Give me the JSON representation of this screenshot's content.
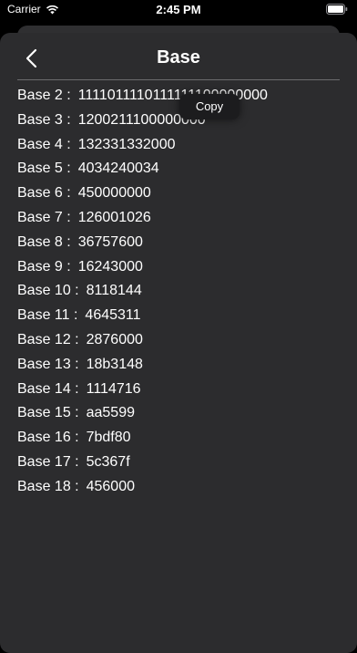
{
  "status_bar": {
    "carrier": "Carrier",
    "time": "2:45 PM",
    "wifi_icon": "wifi-icon",
    "battery_icon": "battery-icon"
  },
  "nav": {
    "title": "Base",
    "back_icon": "chevron-left-icon"
  },
  "bases": [
    {
      "label": "Base 2 :",
      "value": "1111011110111111100000000"
    },
    {
      "label": "Base 3 :",
      "value": "1200211100000000"
    },
    {
      "label": "Base 4 :",
      "value": "132331332000"
    },
    {
      "label": "Base 5 :",
      "value": "4034240034"
    },
    {
      "label": "Base 6 :",
      "value": "450000000"
    },
    {
      "label": "Base 7 :",
      "value": "126001026"
    },
    {
      "label": "Base 8 :",
      "value": "36757600"
    },
    {
      "label": "Base 9 :",
      "value": "16243000"
    },
    {
      "label": "Base 10 :",
      "value": "8118144"
    },
    {
      "label": "Base 11 :",
      "value": "4645311"
    },
    {
      "label": "Base 12 :",
      "value": "2876000"
    },
    {
      "label": "Base 13 :",
      "value": "18b3148"
    },
    {
      "label": "Base 14 :",
      "value": "1114716"
    },
    {
      "label": "Base 15 :",
      "value": "aa5599"
    },
    {
      "label": "Base 16 :",
      "value": "7bdf80"
    },
    {
      "label": "Base 17 :",
      "value": "5c367f"
    },
    {
      "label": "Base 18 :",
      "value": "456000"
    }
  ],
  "context_menu": {
    "copy_label": "Copy"
  },
  "colors": {
    "sheet_background": "#2c2c2e",
    "screen_background": "#000000",
    "text": "#ffffff",
    "menu_background": "#1c1c1e"
  }
}
